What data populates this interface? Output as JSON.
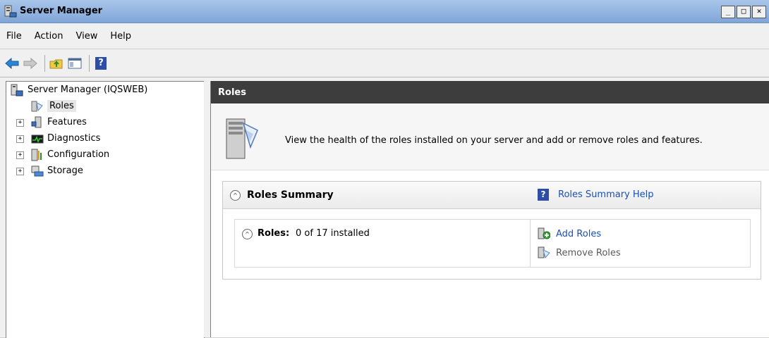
{
  "window": {
    "title": "Server Manager",
    "buttons": {
      "minimize": "_",
      "maximize": "□",
      "close": "✕"
    }
  },
  "menu": [
    {
      "label": "File"
    },
    {
      "label": "Action"
    },
    {
      "label": "View"
    },
    {
      "label": "Help"
    }
  ],
  "toolbar": {
    "icons": [
      "back-arrow-icon",
      "forward-arrow-icon",
      "up-folder-icon",
      "show-hide-console-tree-icon",
      "help-icon"
    ],
    "help_glyph": "?"
  },
  "tree": {
    "root": "Server Manager (IQSWEB)",
    "items": [
      {
        "label": "Roles",
        "selected": true,
        "expandable": false,
        "expander": ""
      },
      {
        "label": "Features",
        "selected": false,
        "expandable": true,
        "expander": "+"
      },
      {
        "label": "Diagnostics",
        "selected": false,
        "expandable": true,
        "expander": "+"
      },
      {
        "label": "Configuration",
        "selected": false,
        "expandable": true,
        "expander": "+"
      },
      {
        "label": "Storage",
        "selected": false,
        "expandable": true,
        "expander": "+"
      }
    ]
  },
  "content": {
    "header": "Roles",
    "description": "View the health of the roles installed on your server and add or remove roles and features.",
    "section": {
      "title": "Roles Summary",
      "help_glyph": "?",
      "help_link": "Roles Summary Help",
      "collapse_glyph": "^",
      "roles_label": "Roles:",
      "roles_value": "0 of 17 installed",
      "actions": [
        {
          "label": "Add Roles",
          "enabled": true
        },
        {
          "label": "Remove Roles",
          "enabled": false
        }
      ]
    }
  },
  "colors": {
    "header_bg": "#3d3d3d",
    "link": "#1a4fb3",
    "title_bar": "#7fa6d8"
  }
}
